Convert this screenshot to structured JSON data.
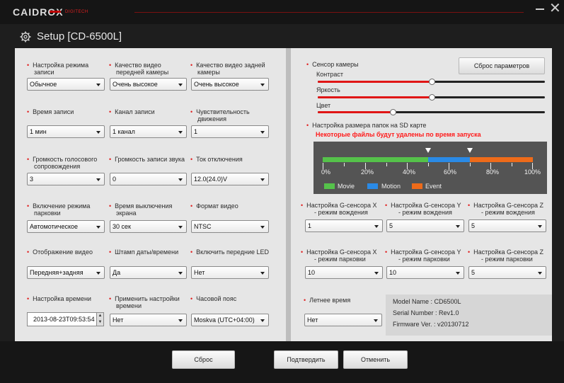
{
  "app": {
    "logo": "CAIDROX",
    "logo_sub": "DIGITECH",
    "minimize": "—",
    "close": "✕",
    "title": "Setup [CD-6500L]",
    "title_icon": "gear-icon"
  },
  "left": {
    "row1": {
      "l1": "Настройка режима",
      "l1b": "записи",
      "l2": "Качество видео",
      "l2b": "передней камеры",
      "l3": "Качество видео задней",
      "l3b": "камеры",
      "v1": "Обычное",
      "v2": "Очень высокое",
      "v3": "Очень высокое"
    },
    "row2": {
      "l1": "Время записи",
      "l2": "Канал записи",
      "l3": "Чувствительность",
      "l3b": "движения",
      "v1": "1 мин",
      "v2": "1 канал",
      "v3": "1"
    },
    "row3": {
      "l1": "Громкость голосового",
      "l1b": "сопровождения",
      "l2": "Громкость записи звука",
      "l3": "Ток отключения",
      "v1": "3",
      "v2": "0",
      "v3": "12.0(24.0)V"
    },
    "row4": {
      "l1": "Включение режима",
      "l1b": "парковки",
      "l2": "Время выключения",
      "l2b": "экрана",
      "l3": "Формат видео",
      "v1": "Автомотическое",
      "v2": "30 сек",
      "v3": "NTSC"
    },
    "row5": {
      "l1": "Отображение видео",
      "l2": "Штамп даты/времени",
      "l3": "Включить передние LED",
      "v1": "Передняя+задняя",
      "v2": "Да",
      "v3": "Нет"
    },
    "row6": {
      "l1": "Настройка времени",
      "l2": "Применить настройки",
      "l2b": "времени",
      "l3": "Часовой пояс",
      "v1": "2013-08-23T09:53:54",
      "v2": "Нет",
      "v3": "Moskva (UTC+04:00)"
    }
  },
  "right": {
    "sensor": "Сенсор камеры",
    "reset_params": "Сброс параметров",
    "contrast": "Контраст",
    "brightness": "Яркость",
    "color": "Цвет",
    "levels": {
      "contrast": 0.5,
      "brightness": 0.5,
      "color": 0.33
    },
    "sd_title": "Настройка размера папок на SD карте",
    "sd_warn": "Некоторые файлы будут удалены по время запуска",
    "sd_pct": [
      "0%",
      "20%",
      "40%",
      "60%",
      "80%",
      "100%"
    ],
    "sd_split": {
      "movie": 50,
      "motion": 20,
      "event": 30
    },
    "legend": {
      "movie": "Movie",
      "motion": "Motion",
      "event": "Event"
    },
    "colors": {
      "movie": "#55c24a",
      "motion": "#2a8ae6",
      "event": "#ee6b1a",
      "accent": "#e02020"
    },
    "gsen": {
      "x_drive": "Настройка G-сенсора X",
      "x_drive_b": "- режим вождения",
      "y_drive": "Настройка G-сенсора Y",
      "y_drive_b": "- режим вождения",
      "z_drive": "Настройка G-сенсора Z",
      "z_drive_b": "- режим вождения",
      "x_park": "Настройка G-сенсора X",
      "x_park_b": "- режим парковки",
      "y_park": "Настройка G-сенсора Y",
      "y_park_b": "- режим парковки",
      "z_park": "Настройка G-сенсора Z",
      "z_park_b": "- режим парковки",
      "v_xd": "1",
      "v_yd": "5",
      "v_zd": "5",
      "v_xp": "10",
      "v_yp": "10",
      "v_zp": "5"
    },
    "summer": "Летнее время",
    "summer_val": "Нет",
    "model": "Model Name : CD6500L",
    "serial": "Serial Number : Rev1.0",
    "firmware": "Firmware Ver. : v20130712"
  },
  "footer": {
    "reset": "Сброс",
    "confirm": "Подтвердить",
    "cancel": "Отменить"
  }
}
